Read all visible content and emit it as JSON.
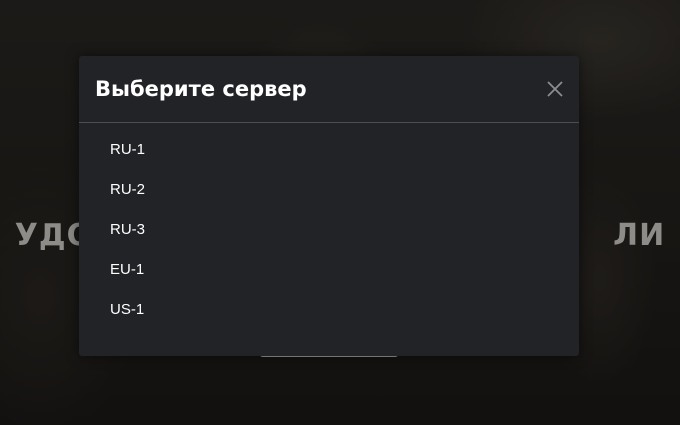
{
  "background": {
    "headline_left": "УДО",
    "headline_right": "ЛИ"
  },
  "modal": {
    "title": "Выберите сервер",
    "close_icon": "close-icon",
    "servers": [
      {
        "label": "RU-1"
      },
      {
        "label": "RU-2"
      },
      {
        "label": "RU-3"
      },
      {
        "label": "EU-1"
      },
      {
        "label": "US-1"
      }
    ]
  },
  "colors": {
    "modal_bg": "#212327",
    "divider": "#4b4e53",
    "text": "#ffffff",
    "headline": "#8e8c89"
  }
}
